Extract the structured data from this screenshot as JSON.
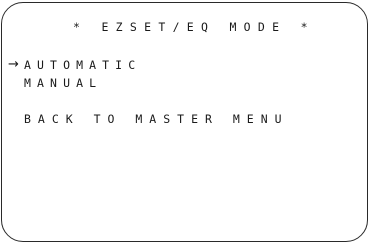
{
  "screen": {
    "title": "* EZSET/EQ MODE *",
    "cursor": "→",
    "menu": [
      {
        "label": "AUTOMATIC"
      },
      {
        "label": "MANUAL"
      },
      {
        "label": "BACK TO MASTER MENU"
      }
    ],
    "selected_index": 0
  }
}
